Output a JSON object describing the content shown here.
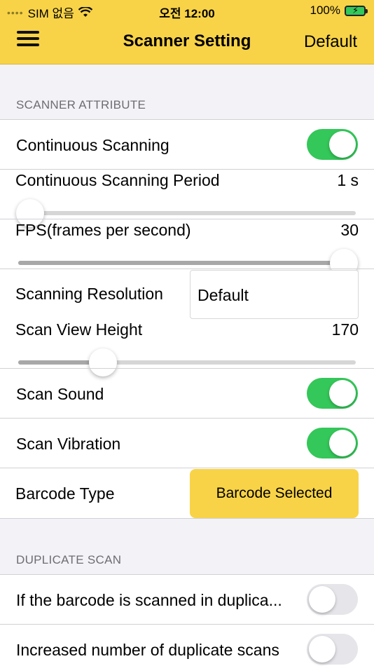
{
  "status_bar": {
    "carrier": "SIM 없음",
    "time": "오전 12:00",
    "battery": "100%"
  },
  "nav": {
    "title": "Scanner Setting",
    "default_label": "Default"
  },
  "scanner_attribute": {
    "section_title": "SCANNER ATTRIBUTE",
    "continuous_scanning": {
      "label": "Continuous Scanning",
      "on": true
    },
    "continuous_period": {
      "label": "Continuous Scanning Period",
      "value": "1 s",
      "level": 0.035
    },
    "fps": {
      "label": "FPS(frames per second)",
      "value": "30",
      "level": 0.965
    },
    "resolution": {
      "label": "Scanning Resolution",
      "value": "Default"
    },
    "view_height": {
      "label": "Scan View Height",
      "value": "170",
      "level": 0.25
    },
    "scan_sound": {
      "label": "Scan Sound",
      "on": true
    },
    "scan_vibration": {
      "label": "Scan Vibration",
      "on": true
    },
    "barcode_type": {
      "label": "Barcode Type",
      "button": "Barcode Selected"
    }
  },
  "duplicate_scan": {
    "section_title": "DUPLICATE SCAN",
    "items": [
      {
        "label": "If the barcode is scanned in duplica...",
        "on": false
      },
      {
        "label": "Increased number of duplicate scans",
        "on": false
      }
    ]
  },
  "colors": {
    "accent": "#f8d347",
    "toggle_on": "#34c759",
    "toggle_off": "#e5e5ea"
  }
}
